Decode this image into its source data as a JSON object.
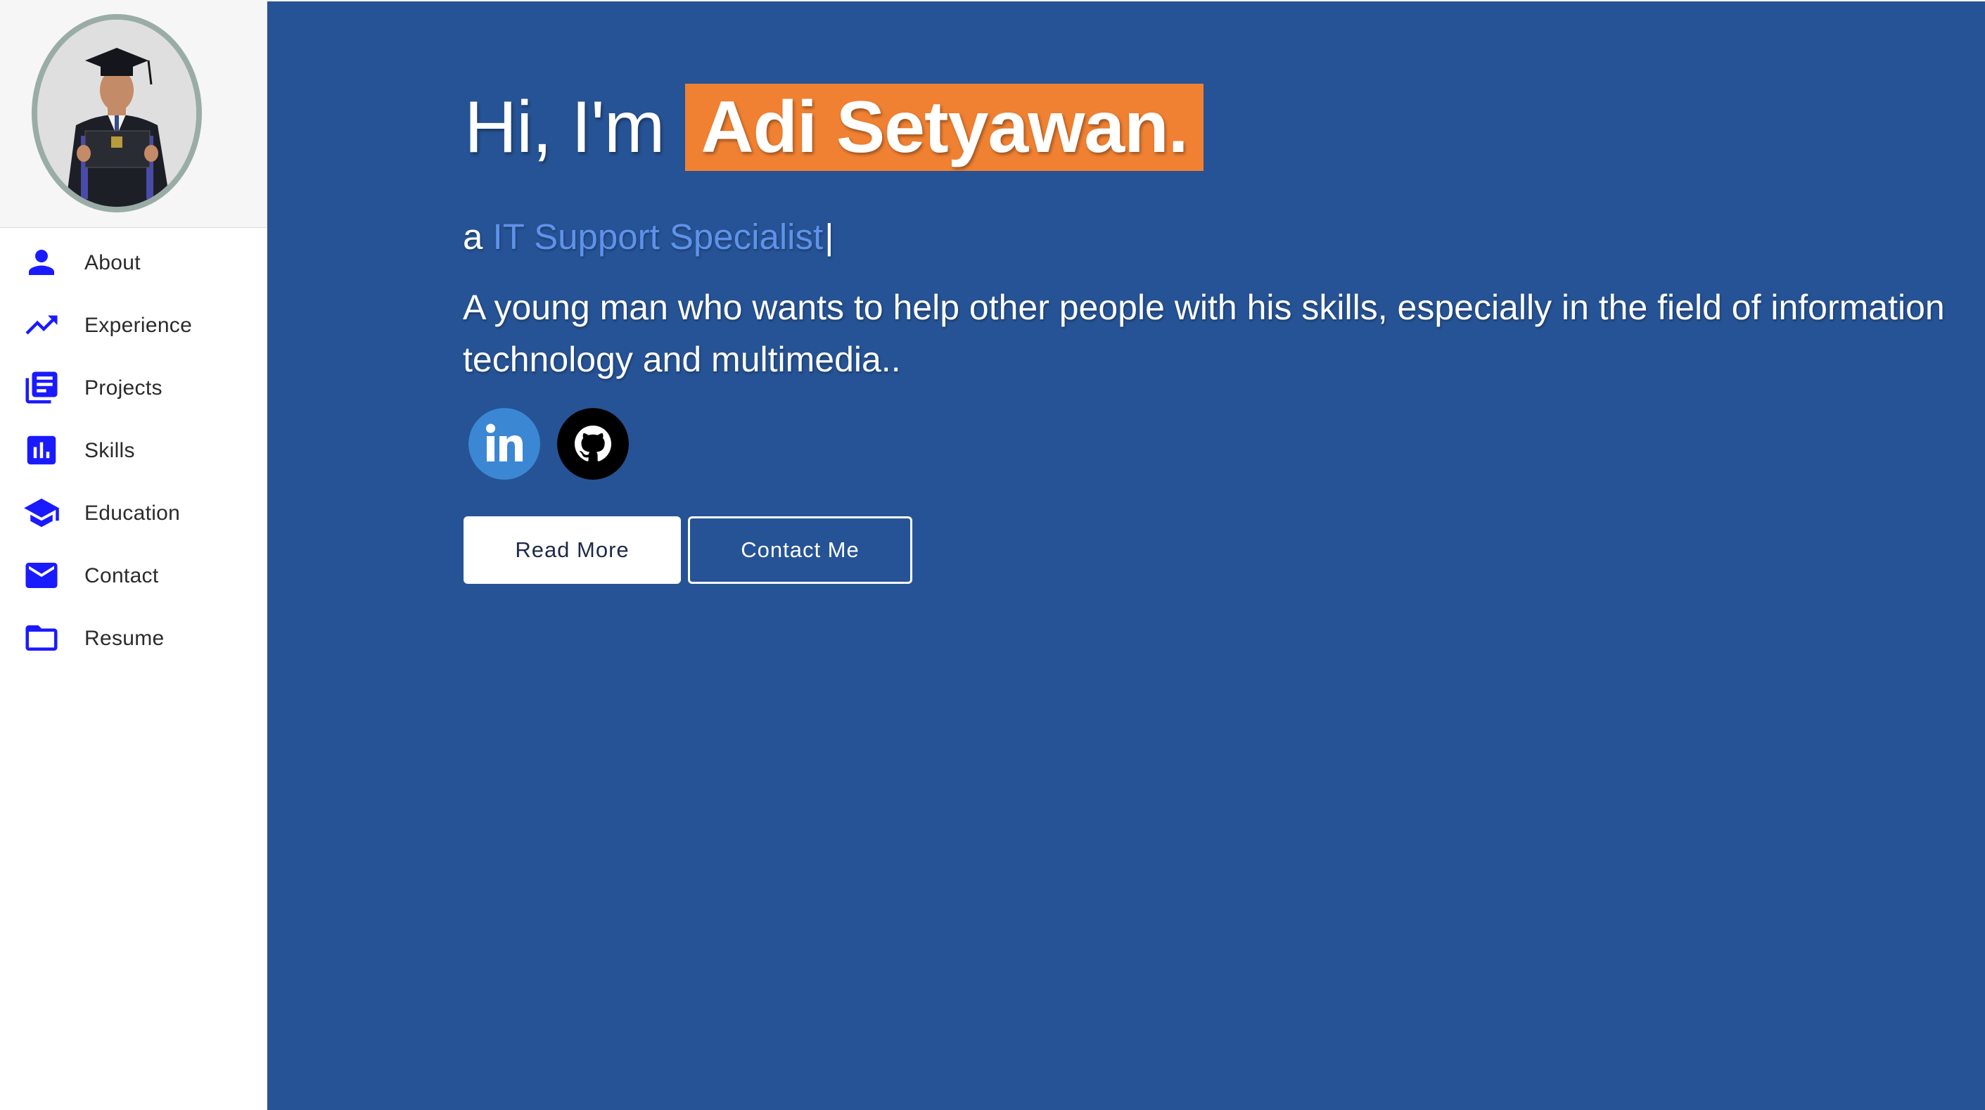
{
  "sidebar": {
    "avatar_alt": "Graduation photo",
    "items": [
      {
        "label": "About",
        "icon": "person-icon"
      },
      {
        "label": "Experience",
        "icon": "trending-up-icon"
      },
      {
        "label": "Projects",
        "icon": "article-icon"
      },
      {
        "label": "Skills",
        "icon": "bar-chart-icon"
      },
      {
        "label": "Education",
        "icon": "graduation-cap-icon"
      },
      {
        "label": "Contact",
        "icon": "mail-icon"
      },
      {
        "label": "Resume",
        "icon": "folder-icon"
      }
    ]
  },
  "hero": {
    "greeting": "Hi, I'm",
    "name": "Adi Setyawan.",
    "tagline_prefix": "a",
    "role": "IT Support Specialist",
    "cursor": "|",
    "bio": "A young man who wants to help other people with his skills, especially in the field of information technology and multimedia..",
    "socials": [
      {
        "name": "LinkedIn",
        "icon": "linkedin-icon"
      },
      {
        "name": "GitHub",
        "icon": "github-icon"
      }
    ],
    "primary_button": "Read More",
    "secondary_button": "Contact Me"
  },
  "colors": {
    "main_bg": "#265395",
    "name_highlight": "#f08132",
    "role_text": "#5f92ea",
    "nav_icon": "#1a1aff",
    "avatar_border": "#9aaca6",
    "linkedin": "#3b87d3",
    "github": "#000000"
  }
}
